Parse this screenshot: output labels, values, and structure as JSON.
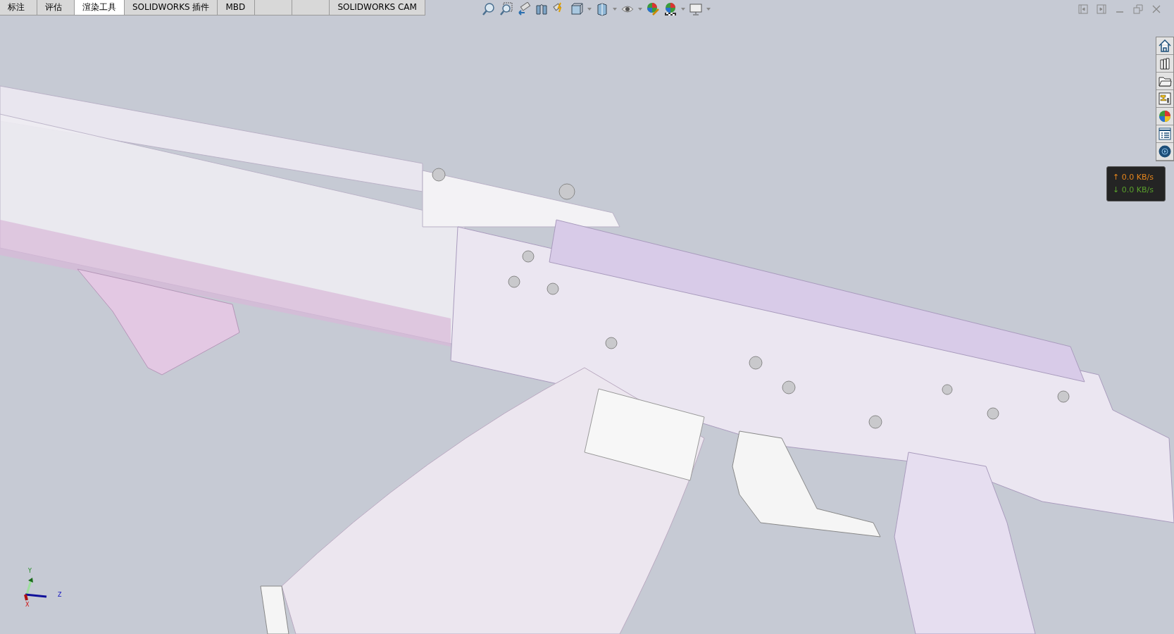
{
  "tabs": [
    {
      "label": "标注",
      "selected": false
    },
    {
      "label": "评估",
      "selected": false
    },
    {
      "label": "渲染工具",
      "selected": true
    },
    {
      "label": "SOLIDWORKS 插件",
      "selected": false
    },
    {
      "label": "MBD",
      "selected": false
    },
    {
      "selected": false
    },
    {
      "selected": false
    },
    {
      "label": "SOLIDWORKS CAM",
      "selected": false
    }
  ],
  "network_monitor": {
    "upload_arrow": "↑",
    "upload": "0.0 KB/s",
    "download_arrow": "↓",
    "download": "0.0 KB/s"
  },
  "axis_triad": {
    "y": "Y",
    "z": "Z",
    "x": "X"
  }
}
